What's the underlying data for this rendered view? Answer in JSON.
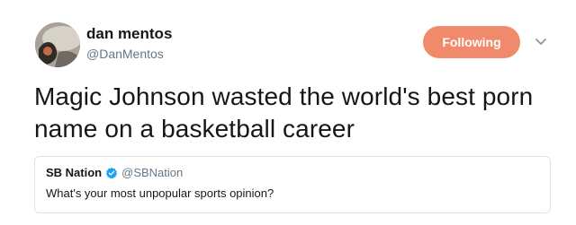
{
  "author": {
    "display_name": "dan mentos",
    "handle": "@DanMentos"
  },
  "follow_button": {
    "label": "Following",
    "color": "#f08a6a"
  },
  "menu": {
    "icon": "chevron-down-icon"
  },
  "tweet": {
    "text": "Magic Johnson wasted the world's best porn name on a basketball career"
  },
  "quoted_tweet": {
    "display_name": "SB Nation",
    "verified_icon": "verified-badge-icon",
    "handle": "@SBNation",
    "text": "What's your most unpopular sports opinion?"
  },
  "colors": {
    "text": "#14171a",
    "secondary": "#657786",
    "verified": "#1da1f2",
    "border": "#dfe3e6"
  }
}
